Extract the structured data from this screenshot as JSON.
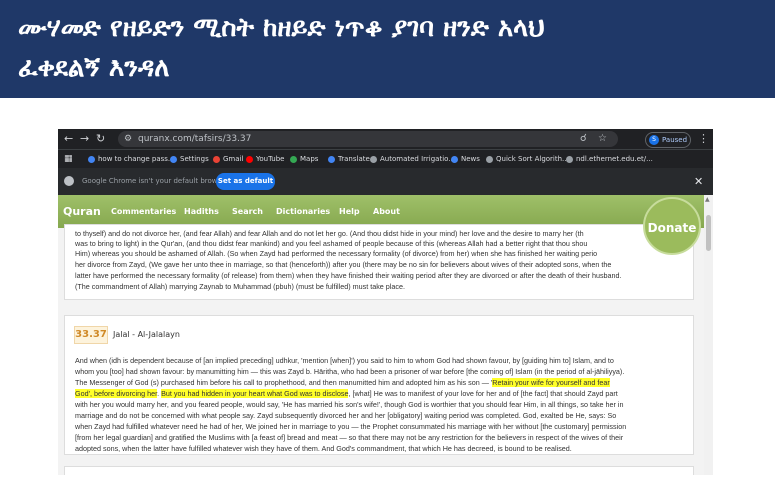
{
  "header": {
    "title_line1": "ሙሃመድ የዘይድን ሚስት ከዘይድ ነጥቆ ያገባ ዘንድ አላህ",
    "title_line2": "ፈቀደልኝ እንዳለ"
  },
  "browser": {
    "url": "quranx.com/tafsirs/33.37",
    "profile_initial": "S",
    "profile_status": "Paused",
    "bookmarks": [
      "how to change pass...",
      "Settings",
      "Gmail",
      "YouTube",
      "Maps",
      "Translate",
      "Automated Irrigatio...",
      "News",
      "Quick Sort Algorith...",
      "ndl.ethernet.edu.et/..."
    ],
    "infobar_text": "Google Chrome isn't your default browser",
    "infobar_button": "Set as default"
  },
  "site": {
    "logo": "Quran",
    "nav": [
      "Commentaries",
      "Hadiths",
      "Search",
      "Dictionaries",
      "Help",
      "About"
    ],
    "donate": "Donate"
  },
  "card1": {
    "lines": [
      "to thyself) and do not divorce her, (and fear Allah) and fear Allah and do not let her go. (And thou didst hide in your mind) her love and the desire to marry her (th",
      "was to bring to light) in the Qur'an, (and thou didst fear mankind) and you feel ashamed of people because of this (whereas Allah had a better right that thou shou",
      "Him) whereas you should be ashamed of Allah. (So when Zayd had performed the necessary formality (of divorce) from her) when she has finished her waiting perio",
      "her divorce from Zayd, (We gave her unto thee in marriage, so that (henceforth)) after you (there may be no sin for believers about wives of their adopted sons, when the",
      "latter have performed the necessary formality (of release) from them) when they have finished their waiting period after they are divorced or after the death of their husband.",
      "(The commandment of Allah) marrying Zaynab to Muhammad (pbuh) (must be fulfilled) must take place."
    ]
  },
  "card2": {
    "verse": "33.37",
    "title": "Jalal - Al-Jalalayn",
    "l1": "And when (idh is dependent because of [an implied preceding] udhkur, 'mention [when]') you said to him to whom God had shown favour, by [guiding him to] Islam, and to",
    "l2": "whom you [too] had shown favour: by manumitting him — this was Zayd b. Hāritha, who had been a prisoner of war before [the coming of] Islam (in the period of al-jāhiliyya).",
    "l3a": "The Messenger of God (s) purchased him before his call to prophethood, and then manumitted him and adopted him as his son — '",
    "l3b": "Retain your wife for yourself and fear",
    "l4a": "God', before divorcing her",
    "l4b": ". ",
    "l4c": "But you had hidden in your heart what God was to disclose",
    "l4d": ", [what] He was to manifest of your love for her and of [the fact] that should Zayd part",
    "l5": "with her you would marry her, and you feared people, would say, 'He has married his son's wife!', though God is worthier that you should fear Him, in all things, so take her in",
    "l6": "marriage and do not be concerned with what people say. Zayd subsequently divorced her and her [obligatory] waiting period was completed. God, exalted be He, says: So",
    "l7": "when Zayd had fulfilled whatever need he had of her, We joined her in marriage to you — the Prophet consummated his marriage with her without [the customary] permission",
    "l8": "[from her legal guardian] and gratified the Muslims with [a feast of] bread and meat — so that there may not be any restriction for the believers in respect of the wives of their",
    "l9": "adopted sons, when the latter have fulfilled whatever wish they have of them. And God's commandment, that which He has decreed, is bound to be realised."
  }
}
